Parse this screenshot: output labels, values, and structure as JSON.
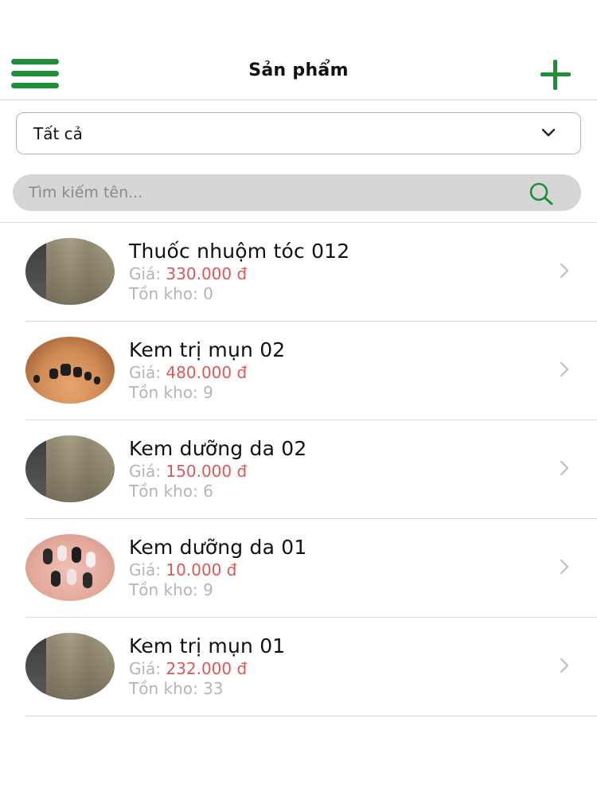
{
  "header": {
    "title": "Sản phẩm",
    "accent_color": "#1f8f3a",
    "menu_icon": "hamburger-menu-icon",
    "add_icon": "plus-icon"
  },
  "filter": {
    "selected": "Tất cả",
    "icon": "chevron-down-icon"
  },
  "search": {
    "placeholder": "Tìm kiếm tên...",
    "value": "",
    "icon": "search-icon",
    "icon_color": "#1f8f3a"
  },
  "products": {
    "price_color": "#e0575a",
    "items": [
      {
        "name": "Thuốc nhuộm tóc 012",
        "price_label": "Giá: ",
        "price": "330.000 đ",
        "stock_label": "Tồn kho: 0",
        "thumbnail": "hair-photo"
      },
      {
        "name": "Kem trị mụn 02",
        "price_label": "Giá: ",
        "price": "480.000 đ",
        "stock_label": "Tồn kho: 9",
        "thumbnail": "toenail-photo"
      },
      {
        "name": "Kem dưỡng da 02",
        "price_label": "Giá: ",
        "price": "150.000 đ",
        "stock_label": "Tồn kho: 6",
        "thumbnail": "hair-photo"
      },
      {
        "name": "Kem dưỡng da 01",
        "price_label": "Giá: ",
        "price": "10.000 đ",
        "stock_label": "Tồn kho: 9",
        "thumbnail": "manicure-photo"
      },
      {
        "name": "Kem trị mụn 01",
        "price_label": "Giá: ",
        "price": "232.000 đ",
        "stock_label": "Tồn kho: 33",
        "thumbnail": "hair-photo"
      }
    ]
  }
}
